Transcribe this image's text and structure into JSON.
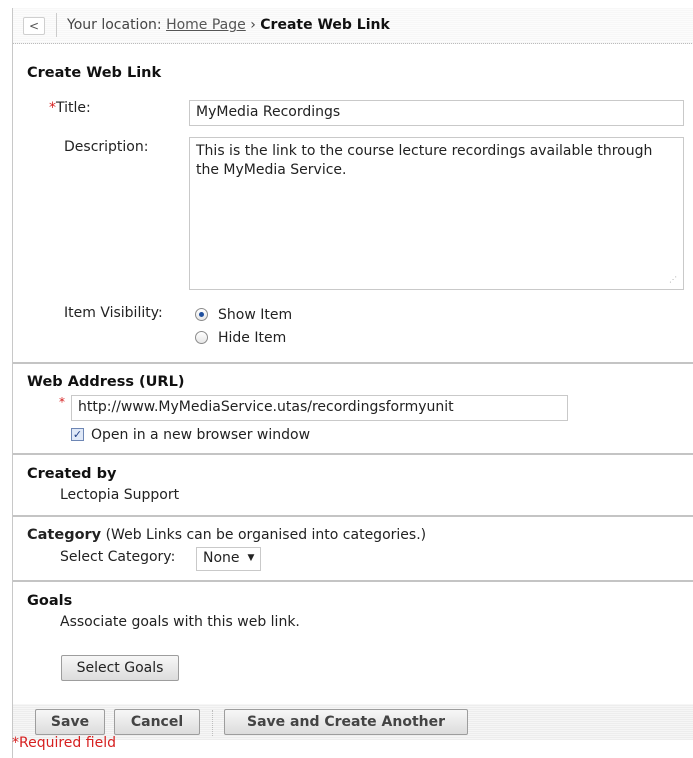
{
  "location": {
    "back_glyph": "<",
    "prefix": "Your location:",
    "home_link": "Home Page",
    "separator": "›",
    "current": "Create Web Link"
  },
  "form": {
    "heading": "Create Web Link",
    "required_marker": "*",
    "title_label": "Title:",
    "title_value": "MyMedia Recordings",
    "description_label": "Description:",
    "description_value": "This is the link to the course lecture recordings available through the MyMedia Service.",
    "visibility_label": "Item Visibility:",
    "visibility_options": [
      {
        "label": "Show Item",
        "selected": true
      },
      {
        "label": "Hide Item",
        "selected": false
      }
    ]
  },
  "web_address": {
    "heading": "Web Address (URL)",
    "url_value": "http://www.MyMediaService.utas/recordingsformyunit",
    "new_window_label": "Open in a new browser window",
    "new_window_checked": true
  },
  "created_by": {
    "heading": "Created by",
    "value": "Lectopia Support"
  },
  "category": {
    "heading": "Category",
    "note": "(Web Links can be organised into categories.)",
    "select_label": "Select Category:",
    "selected_value": "None"
  },
  "goals": {
    "heading": "Goals",
    "description": "Associate goals with this web link.",
    "button_label": "Select Goals"
  },
  "actions": {
    "save_label": "Save",
    "cancel_label": "Cancel",
    "save_create_label": "Save and Create Another"
  },
  "required_note": "*Required field",
  "colors": {
    "required": "#d62020",
    "radio_selected": "#1f4f9e",
    "divider": "#c4c4c4"
  }
}
